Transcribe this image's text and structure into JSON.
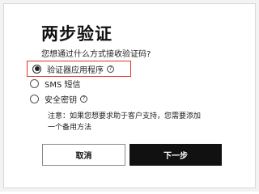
{
  "dialog": {
    "title": "两步验证",
    "question": "您想通过什么方式接收验证码?",
    "options": [
      {
        "label": "验证器应用程序",
        "selected": true,
        "has_info_icon": true,
        "info_icon": "question-circle"
      },
      {
        "label": "SMS 短信",
        "selected": false,
        "has_info_icon": false
      },
      {
        "label": "安全密钥",
        "selected": false,
        "has_info_icon": true,
        "info_icon": "question-circle"
      }
    ],
    "note_line1": "注意：如果您想要求助于客户支持，您需要添加",
    "note_line2": "一个备用方法",
    "cancel_label": "取消",
    "next_label": "下一步",
    "info_glyph": "?"
  },
  "colors": {
    "highlight_border": "#e0332d",
    "primary_button": "#111111",
    "background": "#ffffff"
  }
}
